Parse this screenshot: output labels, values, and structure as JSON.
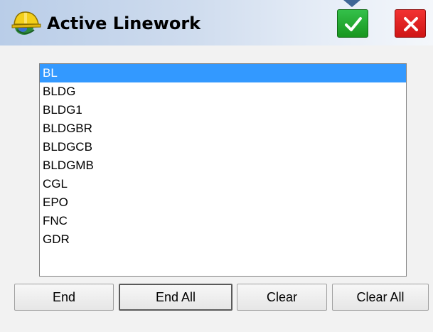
{
  "window": {
    "title": "Active Linework",
    "ok_icon": "checkmark-icon",
    "cancel_icon": "close-icon",
    "colors": {
      "ok": "#22a832",
      "cancel": "#e11f1f",
      "selection": "#3399ff"
    }
  },
  "list": {
    "selected_index": 0,
    "items": [
      {
        "label": "BL"
      },
      {
        "label": "BLDG"
      },
      {
        "label": "BLDG1"
      },
      {
        "label": "BLDGBR"
      },
      {
        "label": "BLDGCB"
      },
      {
        "label": "BLDGMB"
      },
      {
        "label": "CGL"
      },
      {
        "label": "EPO"
      },
      {
        "label": "FNC"
      },
      {
        "label": "GDR"
      }
    ]
  },
  "buttons": {
    "end": "End",
    "end_all": "End All",
    "clear": "Clear",
    "clear_all": "Clear All"
  }
}
